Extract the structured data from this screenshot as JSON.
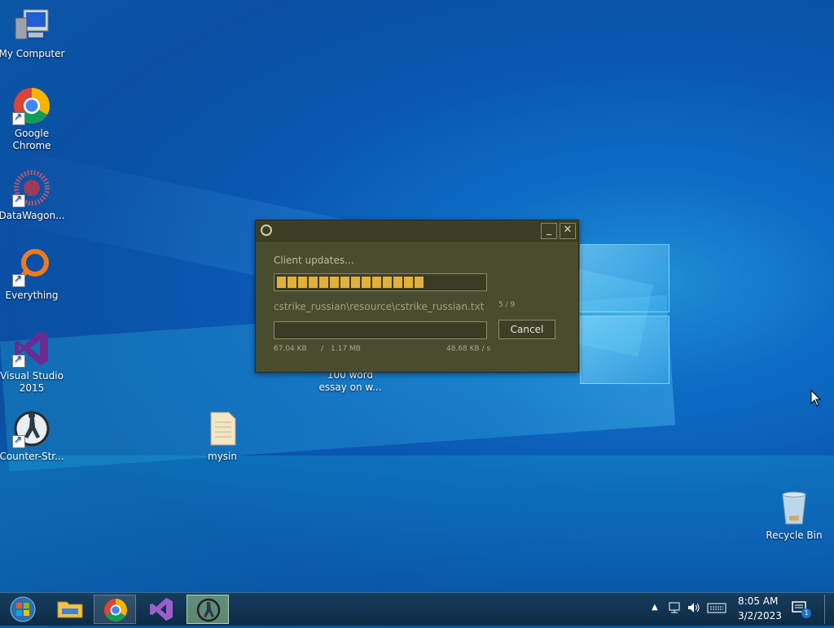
{
  "desktop_icons": [
    {
      "name": "my-computer",
      "label": "My Computer"
    },
    {
      "name": "google-chrome",
      "label": "Google Chrome"
    },
    {
      "name": "datawagon",
      "label": "DataWagon..."
    },
    {
      "name": "everything",
      "label": "Everything"
    },
    {
      "name": "visual-studio",
      "label": "Visual Studio 2015"
    },
    {
      "name": "counter-strike",
      "label": "Counter-Str..."
    },
    {
      "name": "mysin",
      "label": "mysin"
    },
    {
      "name": "essay",
      "label": "100 word essay on w..."
    },
    {
      "name": "recycle-bin",
      "label": "Recycle Bin"
    }
  ],
  "dialog": {
    "status": "Client updates...",
    "file": "cstrike_russian\\resource\\cstrike_russian.txt",
    "count": "5 / 9",
    "downloaded": "67.04 KB",
    "separator": "/",
    "total": "1.17 MB",
    "speed": "48.68 KB / s",
    "cancel_label": "Cancel",
    "overall_progress_segments": 14,
    "file_progress": 0.0
  },
  "taskbar": {
    "apps": [
      "start",
      "file-explorer",
      "google-chrome",
      "visual-studio",
      "counter-strike"
    ],
    "time": "8:05 AM",
    "date": "3/2/2023",
    "notification_count": "1"
  },
  "colors": {
    "progress_fill": "#e2b03a",
    "dialog_bg": "#4b4c2f",
    "taskbar_active": "#9fd096"
  }
}
